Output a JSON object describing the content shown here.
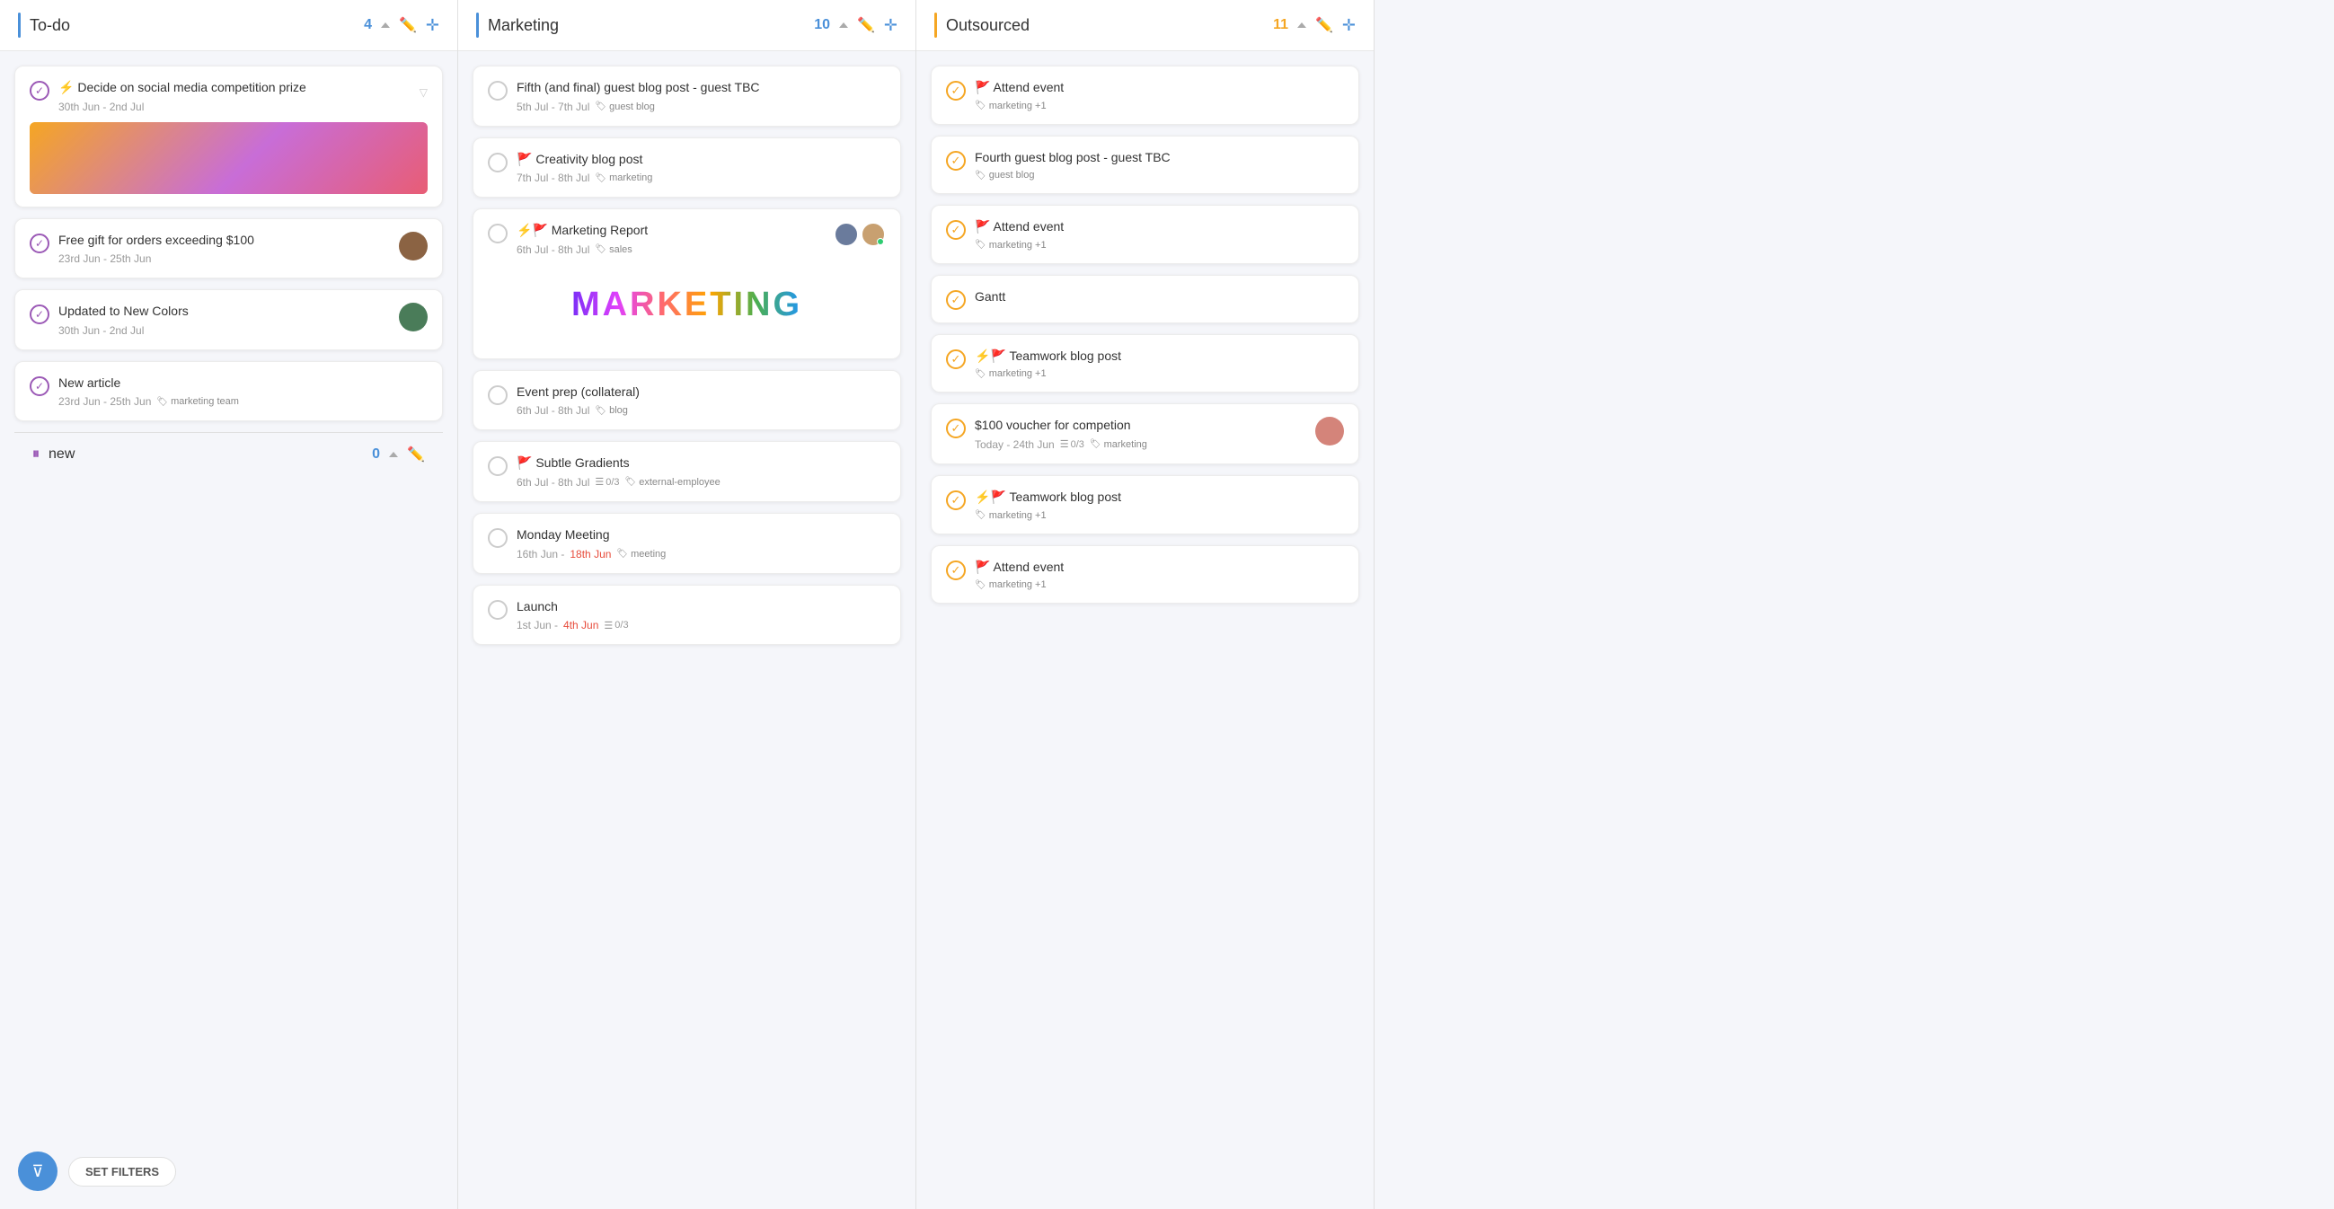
{
  "columns": [
    {
      "id": "todo",
      "title": "To-do",
      "accent": "blue",
      "count": "4",
      "cards": [
        {
          "id": "card-1",
          "checkStyle": "checked-purple",
          "flags": "⚡",
          "title": "Decide on social media competition prize",
          "date": "30th Jun - 2nd Jul",
          "tags": [],
          "hasImage": true,
          "imageType": "gradient",
          "showChevron": true
        },
        {
          "id": "card-2",
          "checkStyle": "checked-purple",
          "flags": "",
          "title": "Free gift for orders exceeding $100",
          "date": "23rd Jun - 25th Jun",
          "tags": [],
          "hasAvatar": true
        },
        {
          "id": "card-3",
          "checkStyle": "checked-purple",
          "flags": "",
          "title": "Updated to New Colors",
          "date": "30th Jun - 2nd Jul",
          "tags": [],
          "hasAvatar": true
        },
        {
          "id": "card-4",
          "checkStyle": "checked-purple",
          "flags": "",
          "title": "New article",
          "date": "23rd Jun - 25th Jun",
          "tags": [
            "marketing team"
          ]
        }
      ],
      "sections": [
        {
          "id": "new",
          "title": "new",
          "count": "0",
          "cards": []
        }
      ]
    },
    {
      "id": "marketing",
      "title": "Marketing",
      "accent": "blue",
      "count": "10",
      "cards": [
        {
          "id": "m-card-1",
          "checkStyle": "",
          "flags": "",
          "title": "Fifth (and final) guest blog post - guest TBC",
          "date": "5th Jul - 7th Jul",
          "tags": [
            "guest blog"
          ]
        },
        {
          "id": "m-card-2",
          "checkStyle": "",
          "flags": "🚩",
          "title": "Creativity blog post",
          "date": "7th Jul - 8th Jul",
          "tags": [
            "marketing"
          ]
        },
        {
          "id": "m-card-3",
          "checkStyle": "",
          "flags": "⚡🚩",
          "title": "Marketing Report",
          "date": "6th Jul - 8th Jul",
          "tags": [
            "sales"
          ],
          "hasAvatarGroup": true,
          "hasMarketingImage": true
        },
        {
          "id": "m-card-4",
          "checkStyle": "",
          "flags": "",
          "title": "Event prep (collateral)",
          "date": "6th Jul - 8th Jul",
          "tags": [
            "blog"
          ]
        },
        {
          "id": "m-card-5",
          "checkStyle": "",
          "flags": "🚩",
          "title": "Subtle Gradients",
          "date": "6th Jul - 8th Jul",
          "subtasks": "0/3",
          "tags": [
            "external-employee"
          ]
        },
        {
          "id": "m-card-6",
          "checkStyle": "",
          "flags": "",
          "title": "Monday Meeting",
          "date": "16th Jun",
          "dateRed": "18th Jun",
          "tags": [
            "meeting"
          ]
        },
        {
          "id": "m-card-7",
          "checkStyle": "",
          "flags": "",
          "title": "Launch",
          "date": "1st Jun",
          "dateRed": "4th Jun",
          "subtasks": "0/3",
          "tags": []
        }
      ]
    },
    {
      "id": "outsourced",
      "title": "Outsourced",
      "accent": "yellow",
      "count": "11",
      "cards": [
        {
          "id": "o-card-1",
          "checkStyle": "checked-yellow",
          "flags": "🚩",
          "title": "Attend event",
          "date": "",
          "tags": [
            "marketing +1"
          ]
        },
        {
          "id": "o-card-2",
          "checkStyle": "checked-yellow",
          "flags": "",
          "title": "Fourth guest blog post - guest TBC",
          "date": "",
          "tags": [
            "guest blog"
          ]
        },
        {
          "id": "o-card-3",
          "checkStyle": "checked-yellow",
          "flags": "🚩",
          "title": "Attend event",
          "date": "",
          "tags": [
            "marketing +1"
          ]
        },
        {
          "id": "o-card-4",
          "checkStyle": "checked-yellow",
          "flags": "",
          "title": "Gantt",
          "date": "",
          "tags": []
        },
        {
          "id": "o-card-5",
          "checkStyle": "checked-yellow",
          "flags": "⚡🚩",
          "title": "Teamwork blog post",
          "date": "",
          "tags": [
            "marketing +1"
          ]
        },
        {
          "id": "o-card-6",
          "checkStyle": "checked-yellow",
          "flags": "",
          "title": "$100 voucher for competion",
          "date": "Today - 24th Jun",
          "subtasks": "0/3",
          "tags": [
            "marketing"
          ],
          "hasAvatar": true
        },
        {
          "id": "o-card-7",
          "checkStyle": "checked-yellow",
          "flags": "⚡🚩",
          "title": "Teamwork blog post",
          "date": "",
          "tags": [
            "marketing +1"
          ]
        },
        {
          "id": "o-card-8",
          "checkStyle": "checked-yellow",
          "flags": "🚩",
          "title": "Attend event",
          "date": "",
          "tags": [
            "marketing +1"
          ]
        }
      ]
    }
  ],
  "bottomBar": {
    "filterLabel": "SET FILTERS"
  }
}
